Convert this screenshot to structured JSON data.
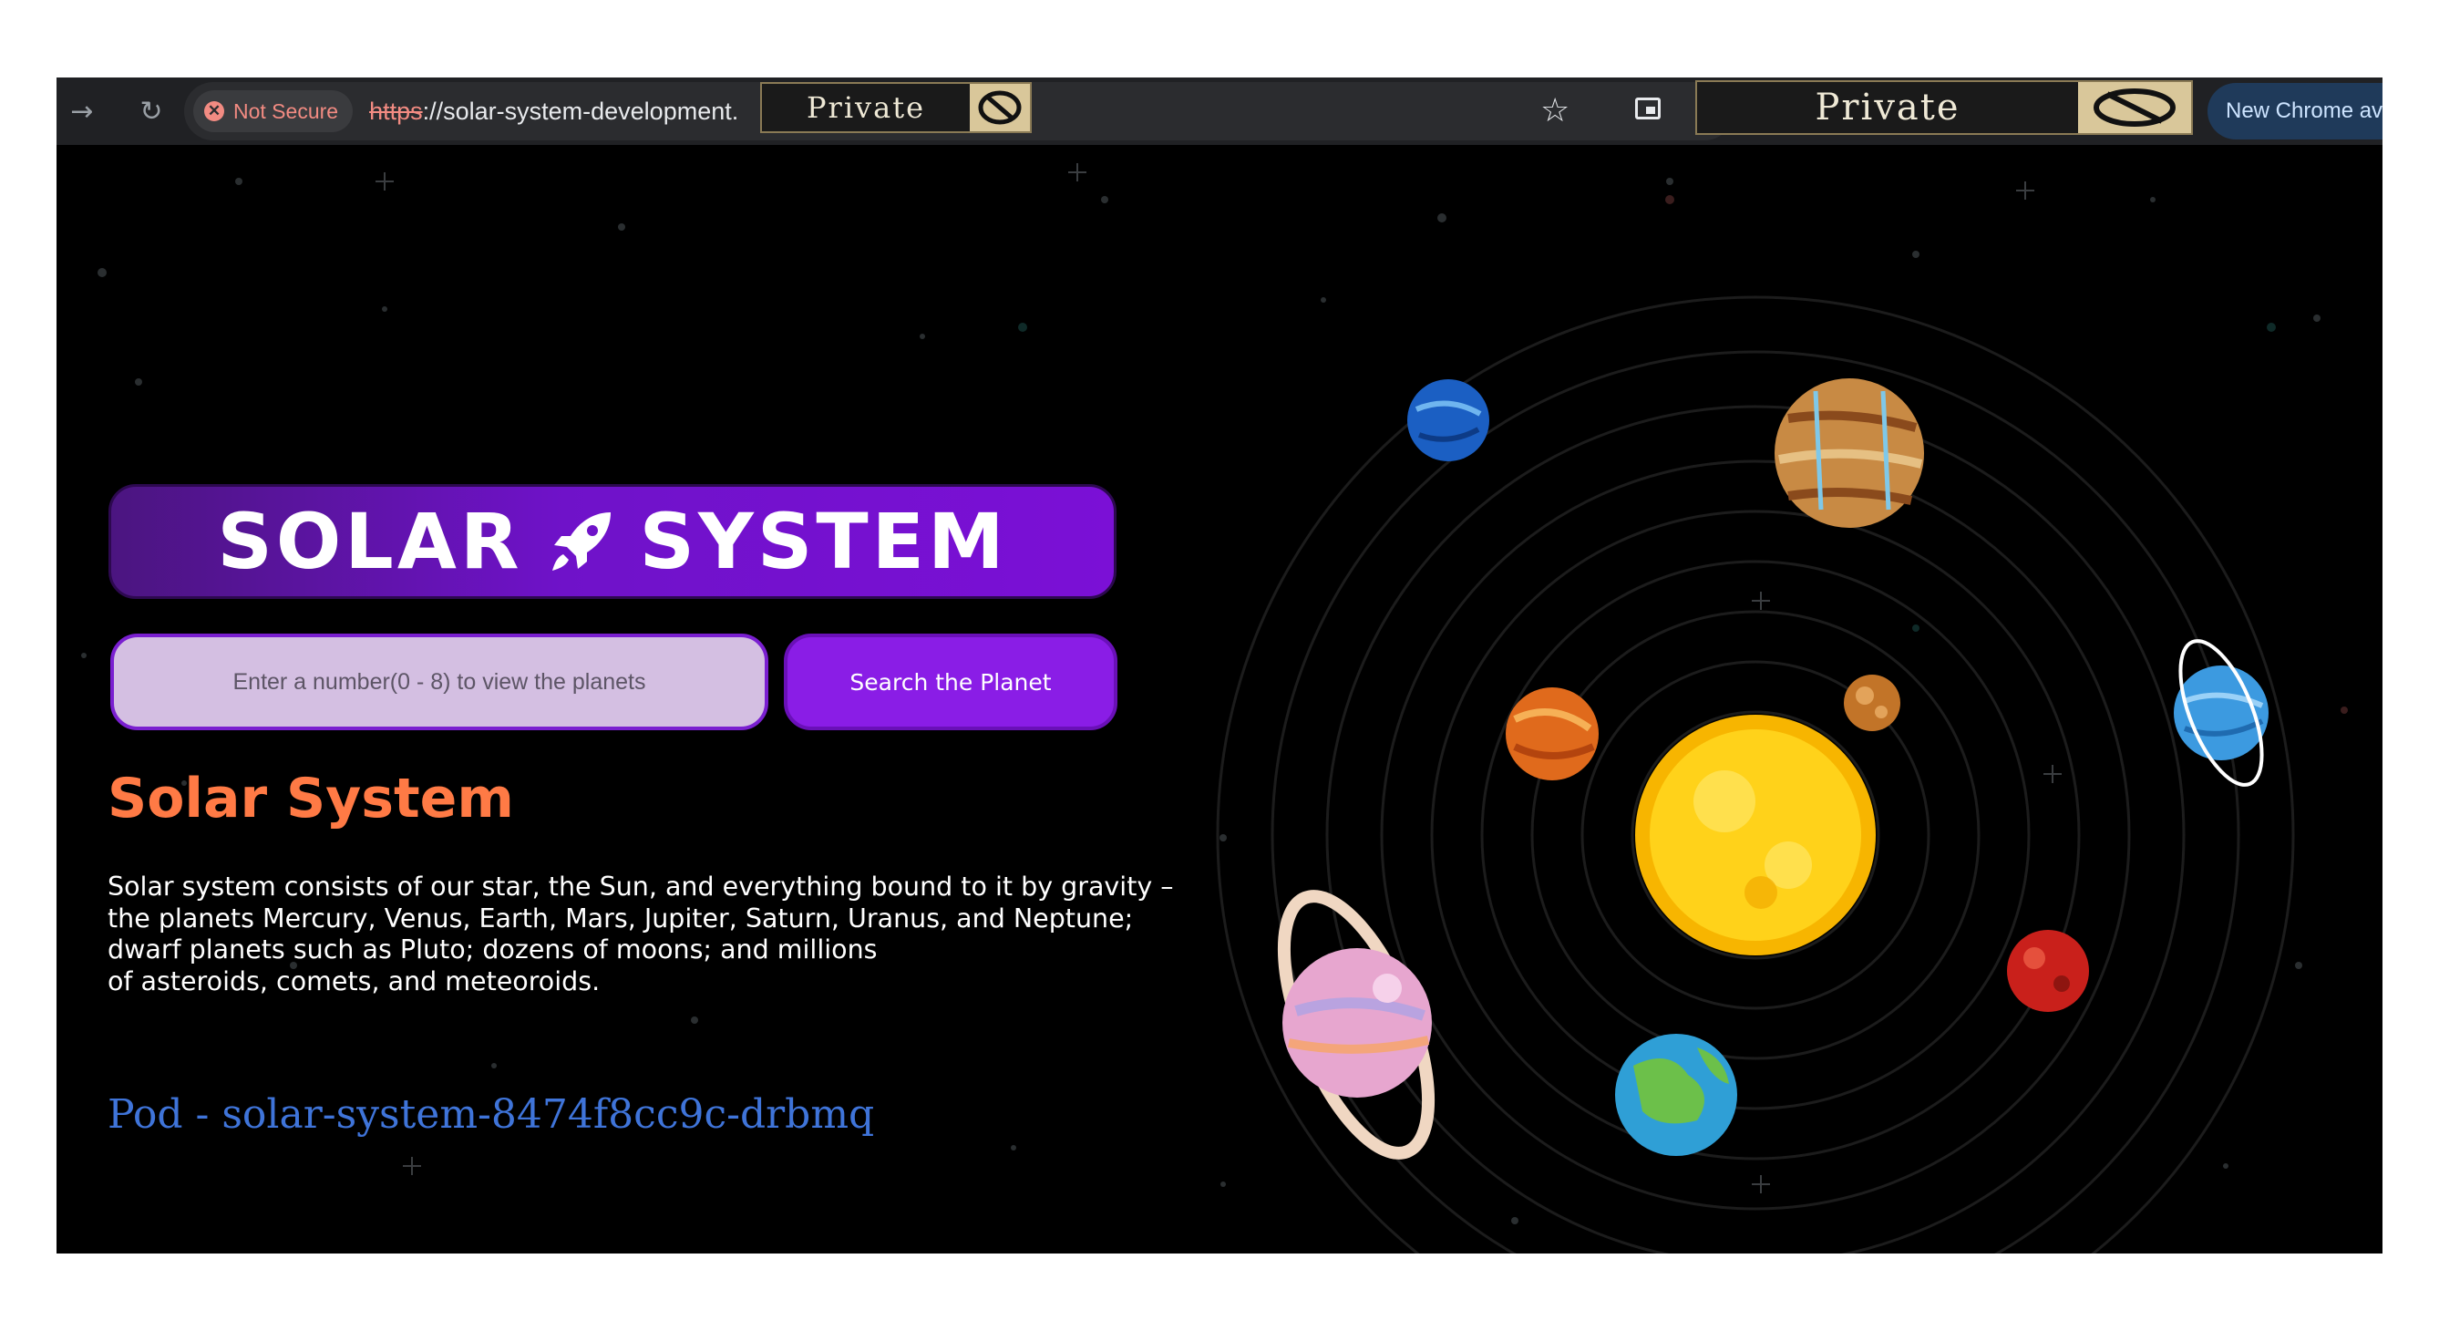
{
  "browser": {
    "security_label": "Not Secure",
    "url_scheme": "https",
    "url_rest": "://solar-system-development.",
    "private_badge_small": "Private",
    "private_badge_large": "Private",
    "new_chrome_label": "New Chrome av"
  },
  "page": {
    "banner_left": "SOLAR",
    "banner_right": "SYSTEM",
    "search": {
      "placeholder": "Enter a number(0 - 8) to view the planets",
      "button_label": "Search the Planet"
    },
    "heading": "Solar System",
    "description_lines": [
      "Solar system consists of our star, the Sun, and everything bound to it by gravity –",
      "the planets Mercury, Venus, Earth, Mars, Jupiter, Saturn, Uranus, and Neptune;",
      "dwarf planets such as Pluto; dozens of moons; and millions",
      "of asteroids, comets, and meteoroids."
    ],
    "pod_label": "Pod - solar-system-8474f8cc9c-drbmq"
  },
  "colors": {
    "accent_purple": "#7b10d6",
    "heading_orange": "#ff7a45",
    "pod_blue": "#3f74d9",
    "input_lavender": "#d4bfe2"
  },
  "icons": [
    "back-arrow-icon",
    "reload-icon",
    "not-secure-icon",
    "star-icon",
    "tab-icon",
    "no-entry-icon",
    "rocket-icon"
  ]
}
